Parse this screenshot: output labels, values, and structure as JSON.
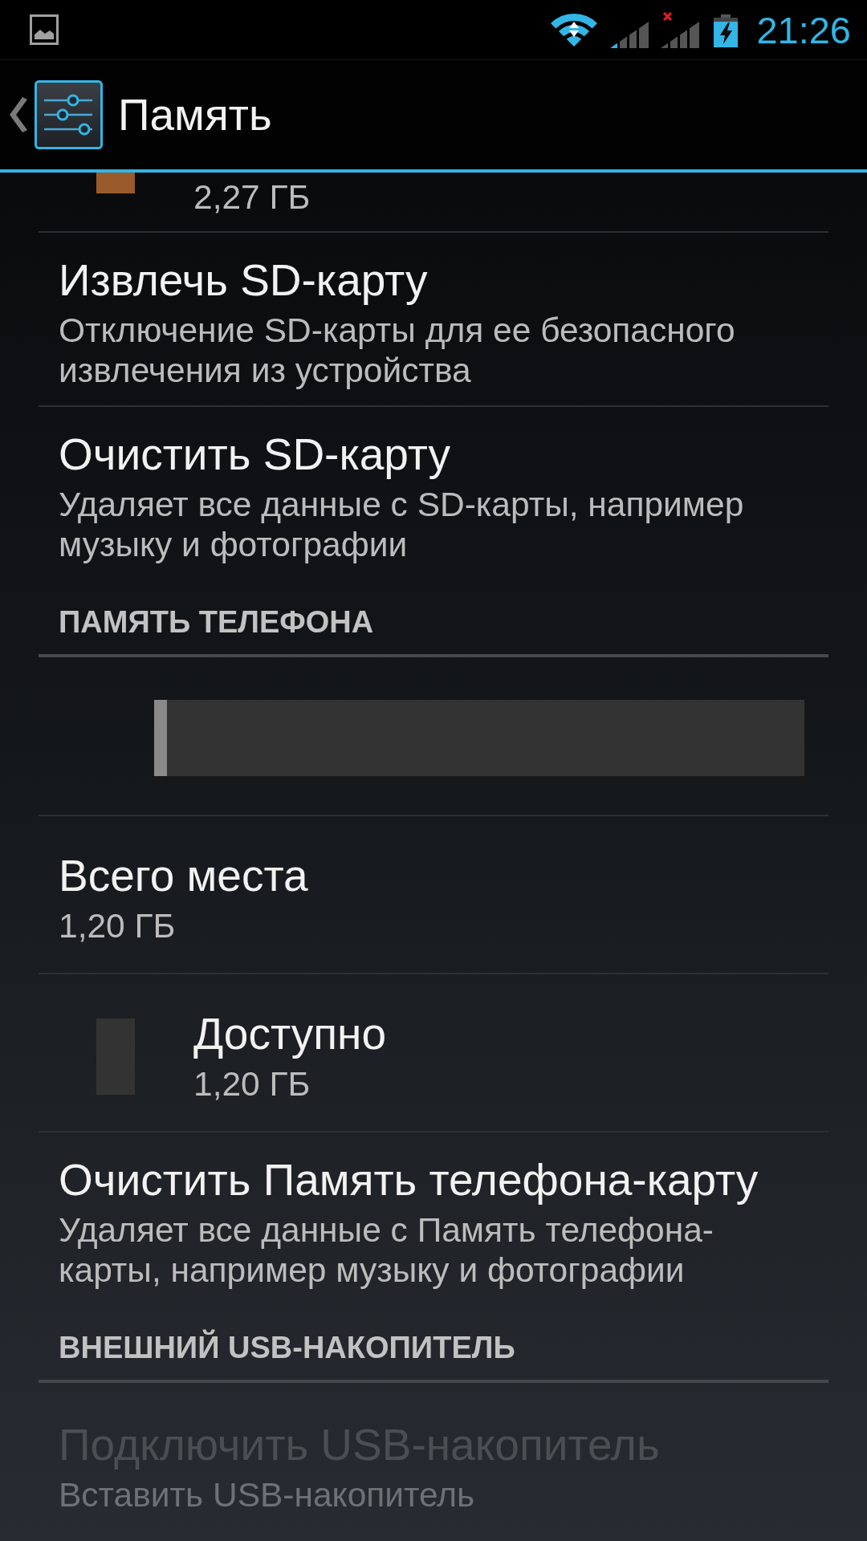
{
  "status_bar": {
    "time": "21:26"
  },
  "action_bar": {
    "title": "Память"
  },
  "preferences": [
    {
      "kind": "legend",
      "summary": "2,27 ГБ",
      "color": "#9a5a2c"
    },
    {
      "kind": "item",
      "title": "Извлечь SD-карту",
      "summary": "Отключение SD-карты для ее безопасного извлечения из устройства",
      "disabled": false
    },
    {
      "kind": "item",
      "title": "Очистить SD-карту",
      "summary": "Удаляет все данные с SD-карты, например музыку и фотографии",
      "disabled": false
    },
    {
      "kind": "category",
      "title": "ПАМЯТЬ ТЕЛЕФОНА"
    },
    {
      "kind": "usage_bar",
      "level": 0.02
    },
    {
      "kind": "item",
      "title": "Всего места",
      "summary": "1,20 ГБ",
      "disabled": false
    },
    {
      "kind": "legend",
      "title": "Доступно",
      "summary": "1,20 ГБ",
      "color": "#333333"
    },
    {
      "kind": "item",
      "title": "Очистить Память телефона-карту",
      "summary": "Удаляет все данные с Память телефона-карты, например музыку и фотографии",
      "disabled": false
    },
    {
      "kind": "category",
      "title": "ВНЕШНИЙ USB-НАКОПИТЕЛЬ"
    },
    {
      "kind": "item",
      "title": "Подключить USB-накопитель",
      "summary": "Вставить USB-накопитель",
      "disabled": true
    }
  ]
}
